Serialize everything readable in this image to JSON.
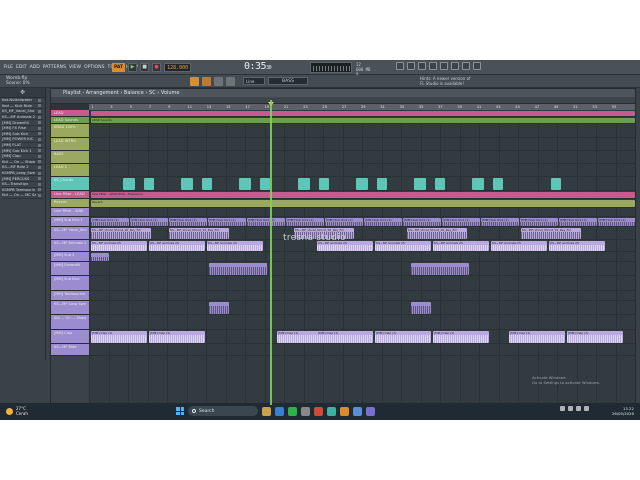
{
  "menu": [
    "FILE",
    "EDIT",
    "ADD",
    "PATTERNS",
    "VIEW",
    "OPTIONS",
    "TOOLS",
    "HELP"
  ],
  "transport": {
    "tempo": "128.000",
    "pattern": "PAT",
    "time": "0:35",
    "time_sub": "30"
  },
  "meters": [
    "12",
    "600 MB",
    "0"
  ],
  "toolbar2": {
    "hint_file": "Womb.flp",
    "hint_sub": "Scene: 0%",
    "snap": "Line",
    "preset": "BASS",
    "notif_title": "Hints: A newer version of",
    "notif_body": "FL Studio is available!"
  },
  "browser": {
    "items": [
      "Kat-Nuttallwater",
      "Ked — Kick Ride",
      "KS_MF_Vocal_Sho",
      "KS—MF Animals 2",
      "[MM] Drownfill",
      "[MM] FX Rise",
      "[MM] Sub Kick",
      "[MM] POWER KIC",
      "[MM] FLAT",
      "[MM] Sub Kick 1",
      "[MM] Clap",
      "Kid — On — Shaw",
      "KS—MF Ride 2",
      "KSMPB_Long_Swe",
      "[MM] PERCUSS",
      "KS—Transition",
      "KSMPB Tambourin",
      "Kid — On — MC Sa"
    ]
  },
  "playlist": {
    "title": "Playlist - Arrangement › Balance › SC › Volume",
    "ruler": [
      "1",
      "3",
      "5",
      "7",
      "9",
      "11",
      "13",
      "15",
      "17",
      "19",
      "21",
      "23",
      "25",
      "27",
      "29",
      "31",
      "33",
      "35",
      "37",
      "39",
      "41",
      "43",
      "45",
      "47",
      "49",
      "51",
      "53",
      "55"
    ],
    "tracks": [
      "LEAD",
      "LEAD Sounds",
      "KNAD 100%",
      "LEAD INTRO",
      "BASS",
      "LEAD 2",
      "KS_Chords",
      "Line Filter - LEAD",
      "Reverb",
      "Line Filter - SINE",
      "[MM] Sub Kick 1",
      "KS—MF Vocal_Sho",
      "KS—MF Animals 2",
      "[MM] Sub 2",
      "[MM] Drownfill",
      "[MM] Sub Kick",
      "[MM] Tambourine",
      "KS—MF Long Swe",
      "Kid — On — Shaw",
      "[MM] Clap",
      "KS—MF Ride"
    ],
    "clip_labels": {
      "lead_sounds": "LEAD Sounds",
      "line_filter": "Line Filter - LEAD BUS - Frequency",
      "reverb": "Reverb",
      "sub_kick": "[MM] Sub Kick (1)",
      "vocal": "KS—MF_Vocal_Shout_16_Key_Fm",
      "animals": "KS—MF Animals 2S",
      "clap": "[MM] Clap (1)"
    }
  },
  "watermark": "tresna studio",
  "activate": {
    "line1": "Activate Windows",
    "line2": "Go to Settings to activate Windows."
  },
  "taskbar": {
    "weather_temp": "27°C",
    "weather_desc": "Cerah",
    "search": "Search",
    "time": "13.22",
    "date": "26/05/2026"
  },
  "colors": {
    "accent": "#e08b2b",
    "playhead": "#7fd35a",
    "teal": "#5ec6b7",
    "pink": "#c75a8e",
    "olive": "#9aa860",
    "purple": "#9b8ccf",
    "green": "#6b9e4f"
  }
}
